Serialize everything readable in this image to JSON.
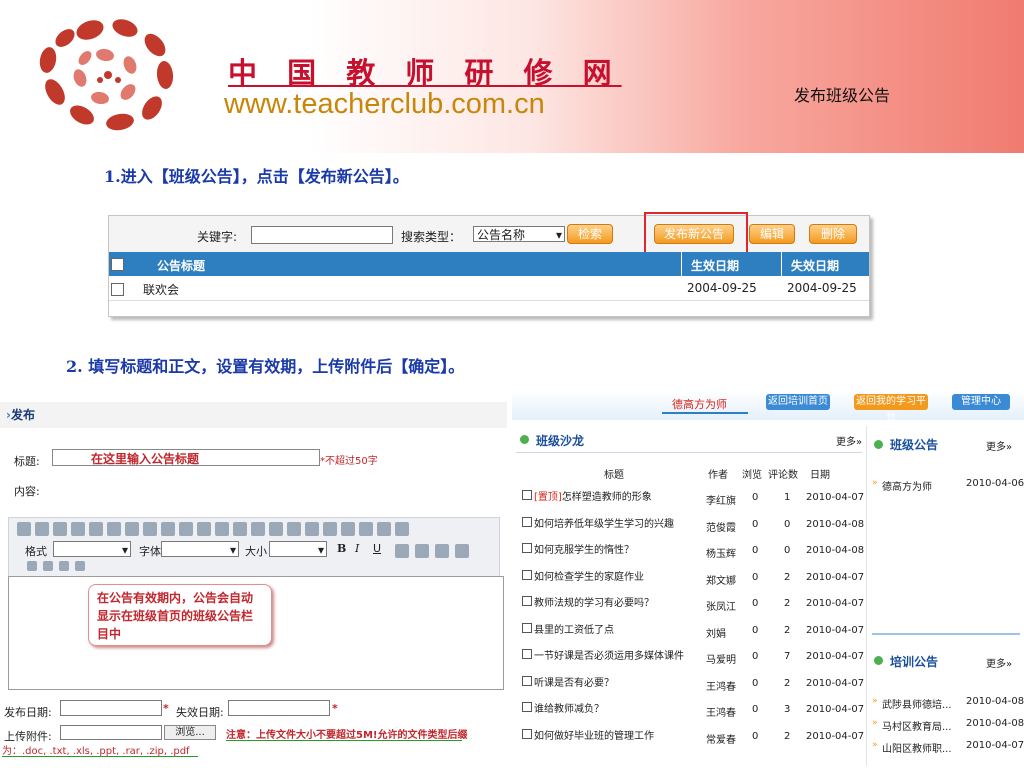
{
  "header": {
    "site_title": "中 国 教 师 研 修 网",
    "site_url": "www.teacherclub.com.cn",
    "slide_title": "发布班级公告"
  },
  "steps": {
    "step1": "1.进入【班级公告】，点击【发布新公告】。",
    "step2": "2. 填写标题和正文，设置有效期，上传附件后【确定】。"
  },
  "shot1": {
    "keyword_label": "关键字:",
    "search_type_label": "搜索类型：",
    "search_type_value": "公告名称",
    "buttons": {
      "search": "检索",
      "publish": "发布新公告",
      "edit": "编辑",
      "delete": "删除"
    },
    "columns": {
      "title": "公告标题",
      "start": "生效日期",
      "end": "失效日期"
    },
    "rows": [
      {
        "title": "联欢会",
        "start": "2004-09-25",
        "end": "2004-09-25"
      }
    ]
  },
  "shot2_left": {
    "section": "发布",
    "title_label": "标题:",
    "title_placeholder": "在这里输入公告标题",
    "title_hint": "*不超过50字",
    "content_label": "内容:",
    "toolbar": {
      "format": "格式",
      "font": "字体",
      "size": "大小"
    },
    "callout": "在公告有效期内，公告会自动显示在班级首页的班级公告栏目中",
    "start_date_label": "发布日期:",
    "end_date_label": "失效日期:",
    "attach_label": "上传附件:",
    "browse_button": "浏览...",
    "note": "注意：上传文件大小不要超过5M!允许的文件类型后缀",
    "note_types": "为：.doc, .txt, .xls, .ppt, .rar, .zip, .pdf"
  },
  "shot2_right": {
    "top_user": "德高方为师",
    "nav": [
      "返回培训首页",
      "返回我的学习平台",
      "管理中心"
    ],
    "salon": {
      "title": "班级沙龙",
      "more": "更多»",
      "columns": [
        "标题",
        "作者",
        "浏览",
        "评论数",
        "日期"
      ],
      "rows": [
        {
          "title": "[置顶]怎样塑造教师的形象",
          "author": "李红旗",
          "views": "0",
          "comments": "1",
          "date": "2010-04-07"
        },
        {
          "title": "如何培养低年级学生学习的兴趣",
          "author": "范俊霞",
          "views": "0",
          "comments": "0",
          "date": "2010-04-08"
        },
        {
          "title": "如何克服学生的惰性？",
          "author": "杨玉辉",
          "views": "0",
          "comments": "0",
          "date": "2010-04-08"
        },
        {
          "title": "如何检查学生的家庭作业",
          "author": "郑文娜",
          "views": "0",
          "comments": "2",
          "date": "2010-04-07"
        },
        {
          "title": "教师法规的学习有必要吗？",
          "author": "张凤江",
          "views": "0",
          "comments": "2",
          "date": "2010-04-07"
        },
        {
          "title": "县里的工资低了点",
          "author": "刘娟",
          "views": "0",
          "comments": "2",
          "date": "2010-04-07"
        },
        {
          "title": "一节好课是否必须运用多媒体课件",
          "author": "马爱明",
          "views": "0",
          "comments": "7",
          "date": "2010-04-07"
        },
        {
          "title": "听课是否有必要？",
          "author": "王鸿春",
          "views": "0",
          "comments": "2",
          "date": "2010-04-07"
        },
        {
          "title": "谁给教师减负？",
          "author": "王鸿春",
          "views": "0",
          "comments": "3",
          "date": "2010-04-07"
        },
        {
          "title": "如何做好毕业班的管理工作",
          "author": "常爱春",
          "views": "0",
          "comments": "2",
          "date": "2010-04-07"
        }
      ]
    },
    "notice": {
      "title": "班级公告",
      "more": "更多»",
      "items": [
        {
          "title": "德高方为师",
          "date": "2010-04-06"
        }
      ]
    },
    "training": {
      "title": "培训公告",
      "more": "更多»",
      "items": [
        {
          "title": "武陟县师德培...",
          "date": "2010-04-08"
        },
        {
          "title": "马村区教育局...",
          "date": "2010-04-08"
        },
        {
          "title": "山阳区教师职...",
          "date": "2010-04-07"
        }
      ]
    }
  },
  "colors": {
    "brand_red": "#c8102e",
    "url_gold": "#c8860a",
    "step_blue": "#1a3aa8",
    "header_blue": "#2e7fbf",
    "button_orange": "#f39a1e",
    "highlight_red": "#e0262c"
  }
}
